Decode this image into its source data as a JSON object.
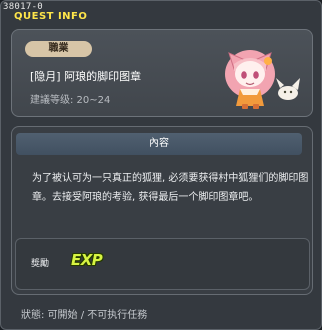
{
  "window": {
    "quest_id": "38017-0",
    "title": "QUEST INFO"
  },
  "header": {
    "job_badge": "職業",
    "quest_name": "[隐月] 阿琅的脚印图章",
    "level_label": "建議等级: 20~24",
    "npc_icon": "fox-girl-npc-icon"
  },
  "content": {
    "heading": "內容",
    "description": "为了被认可为一只真正的狐狸, 必须要获得村中狐狸们的脚印图章。去接受阿琅的考验, 获得最后一个脚印图章吧。"
  },
  "reward": {
    "label": "獎勵",
    "exp_label": "EXP"
  },
  "status": "狀態: 可開始 / 不可执行任務",
  "colors": {
    "title": "#ffe64a",
    "badge_bg": "#d7c5a7",
    "exp": "#d8f542",
    "panel": "#41464c"
  }
}
